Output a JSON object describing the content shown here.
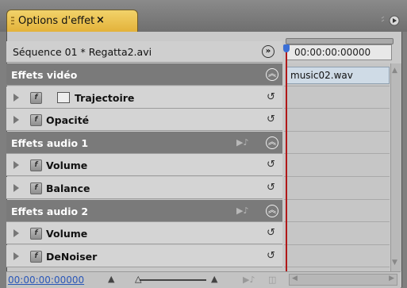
{
  "panel": {
    "tab_title": "Options d'effet",
    "tab_close": "×",
    "sequence_label": "Séquence 01 * Regatta2.avi",
    "timecode": "00:00:00:00000",
    "clip_name": "music02.wav",
    "footer_timecode": "00:00:00:00000"
  },
  "rows": [
    {
      "kind": "category",
      "label": "Effets vidéo"
    },
    {
      "kind": "effect",
      "label": "Trajectoire",
      "icon": "motion-icon"
    },
    {
      "kind": "effect",
      "label": "Opacité"
    },
    {
      "kind": "category",
      "label": "Effets audio 1"
    },
    {
      "kind": "effect",
      "label": "Volume"
    },
    {
      "kind": "effect",
      "label": "Balance"
    },
    {
      "kind": "category",
      "label": "Effets audio 2"
    },
    {
      "kind": "effect",
      "label": "Volume"
    },
    {
      "kind": "effect",
      "label": "DeNoiser"
    }
  ],
  "colors": {
    "tab_accent": "#e3b23a",
    "category_bg": "#7a7a7a",
    "effect_bg": "#d4d4d4",
    "playhead": "#b01818",
    "timecode_link": "#2a57b8"
  }
}
